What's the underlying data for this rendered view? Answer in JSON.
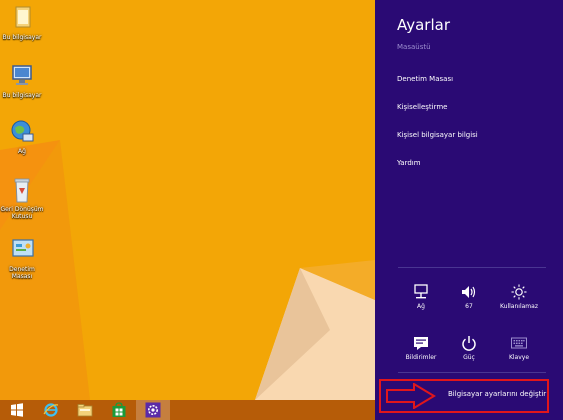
{
  "desktop": {
    "icons": [
      {
        "label": "Bu bilgisayar",
        "icon": "folder-icon"
      },
      {
        "label": "Bu bilgisayar",
        "icon": "computer-icon"
      },
      {
        "label": "Ağ",
        "icon": "network-globe-icon"
      },
      {
        "label": "Geri Dönüşüm Kutusu",
        "icon": "recycle-bin-icon"
      },
      {
        "label": "Denetim Masası",
        "icon": "control-panel-icon"
      }
    ]
  },
  "taskbar": {
    "items": [
      "windows-logo-icon",
      "internet-explorer-icon",
      "file-explorer-icon",
      "store-icon",
      "settings-gear-icon"
    ]
  },
  "charm": {
    "title": "Ayarlar",
    "subtitle": "Masaüstü",
    "links": [
      "Denetim Masası",
      "Kişiselleştirme",
      "Kişisel bilgisayar bilgisi",
      "Yardım"
    ],
    "quick_settings": [
      {
        "label": "Ağ",
        "icon": "network-icon"
      },
      {
        "label": "67",
        "icon": "volume-icon"
      },
      {
        "label": "Kullanılamaz",
        "icon": "brightness-icon"
      },
      {
        "label": "Bildirimler",
        "icon": "notifications-icon"
      },
      {
        "label": "Güç",
        "icon": "power-icon"
      },
      {
        "label": "Klavye",
        "icon": "keyboard-icon"
      }
    ],
    "change_pc_settings": "Bilgisayar ayarlarını değiştir"
  },
  "colors": {
    "charm_bg": "#2a0a74",
    "wallpaper": "#f3a606",
    "taskbar": "#b65c08",
    "highlight": "#e0161b"
  }
}
